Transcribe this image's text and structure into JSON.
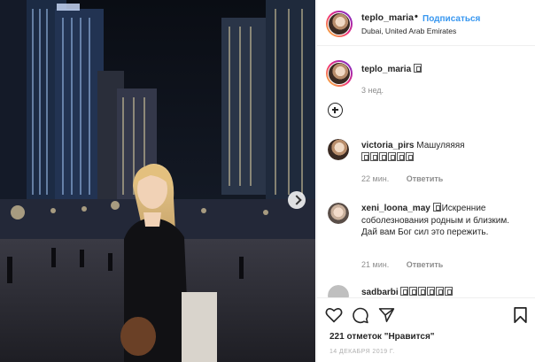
{
  "post": {
    "author": "teplo_maria",
    "follow_label": "Подписаться",
    "separator": "•",
    "location": "Dubai, United Arab Emirates",
    "caption_author": "teplo_maria",
    "caption_time": "3 нед."
  },
  "comments": [
    {
      "user": "victoria_pirs",
      "text": "Машуляяяя",
      "time": "22 мин.",
      "reply": "Ответить"
    },
    {
      "user": "xeni_loona_may",
      "text": "Искренние соболезнования родным и близким. Дай вам Бог сил это пережить.",
      "time": "21 мин.",
      "reply": "Ответить"
    },
    {
      "user": "sadbarbi",
      "text": ""
    }
  ],
  "actions": {
    "icons": [
      "heart-icon",
      "comment-icon",
      "share-icon",
      "bookmark-icon"
    ],
    "likes": "221 отметок \"Нравится\"",
    "date": "14 ДЕКАБРЯ 2019 Г."
  },
  "colors": {
    "accent": "#3897f0",
    "text": "#262626",
    "muted": "#8e8e8e"
  }
}
